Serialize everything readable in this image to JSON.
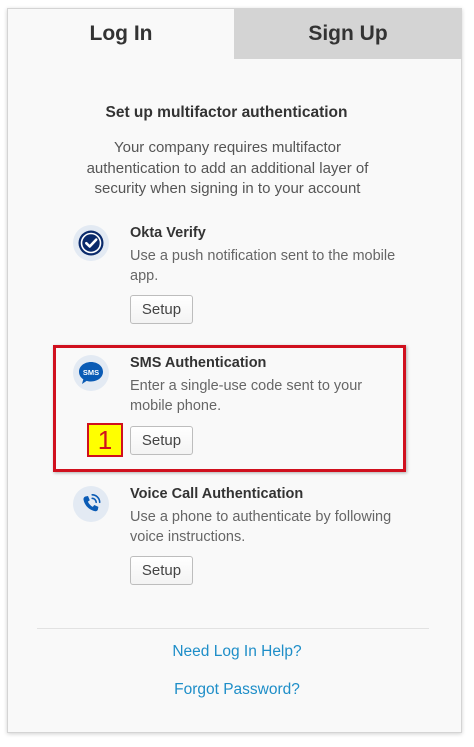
{
  "tabs": {
    "login": "Log In",
    "signup": "Sign Up"
  },
  "title": "Set up multifactor authentication",
  "description": "Your company requires multifactor authentication to add an additional layer of security when signing in to your account",
  "factors": [
    {
      "name": "Okta Verify",
      "text": "Use a push notification sent to the mobile app.",
      "button": "Setup",
      "icon": "okta-verify-icon"
    },
    {
      "name": "SMS Authentication",
      "text": "Enter a single-use code sent to your mobile phone.",
      "button": "Setup",
      "icon": "sms-icon",
      "icon_text": "SMS"
    },
    {
      "name": "Voice Call Authentication",
      "text": "Use a phone to authenticate by following voice instructions.",
      "button": "Setup",
      "icon": "phone-call-icon"
    }
  ],
  "annotation": {
    "step": "1",
    "color": "#d0101e",
    "badge_color": "#ffff00"
  },
  "links": {
    "help": "Need Log In Help?",
    "forgot": "Forgot Password?"
  },
  "colors": {
    "link": "#1e8ec8",
    "icon_blue": "#0a5bb5",
    "inactive_tab": "#d4d4d4"
  }
}
